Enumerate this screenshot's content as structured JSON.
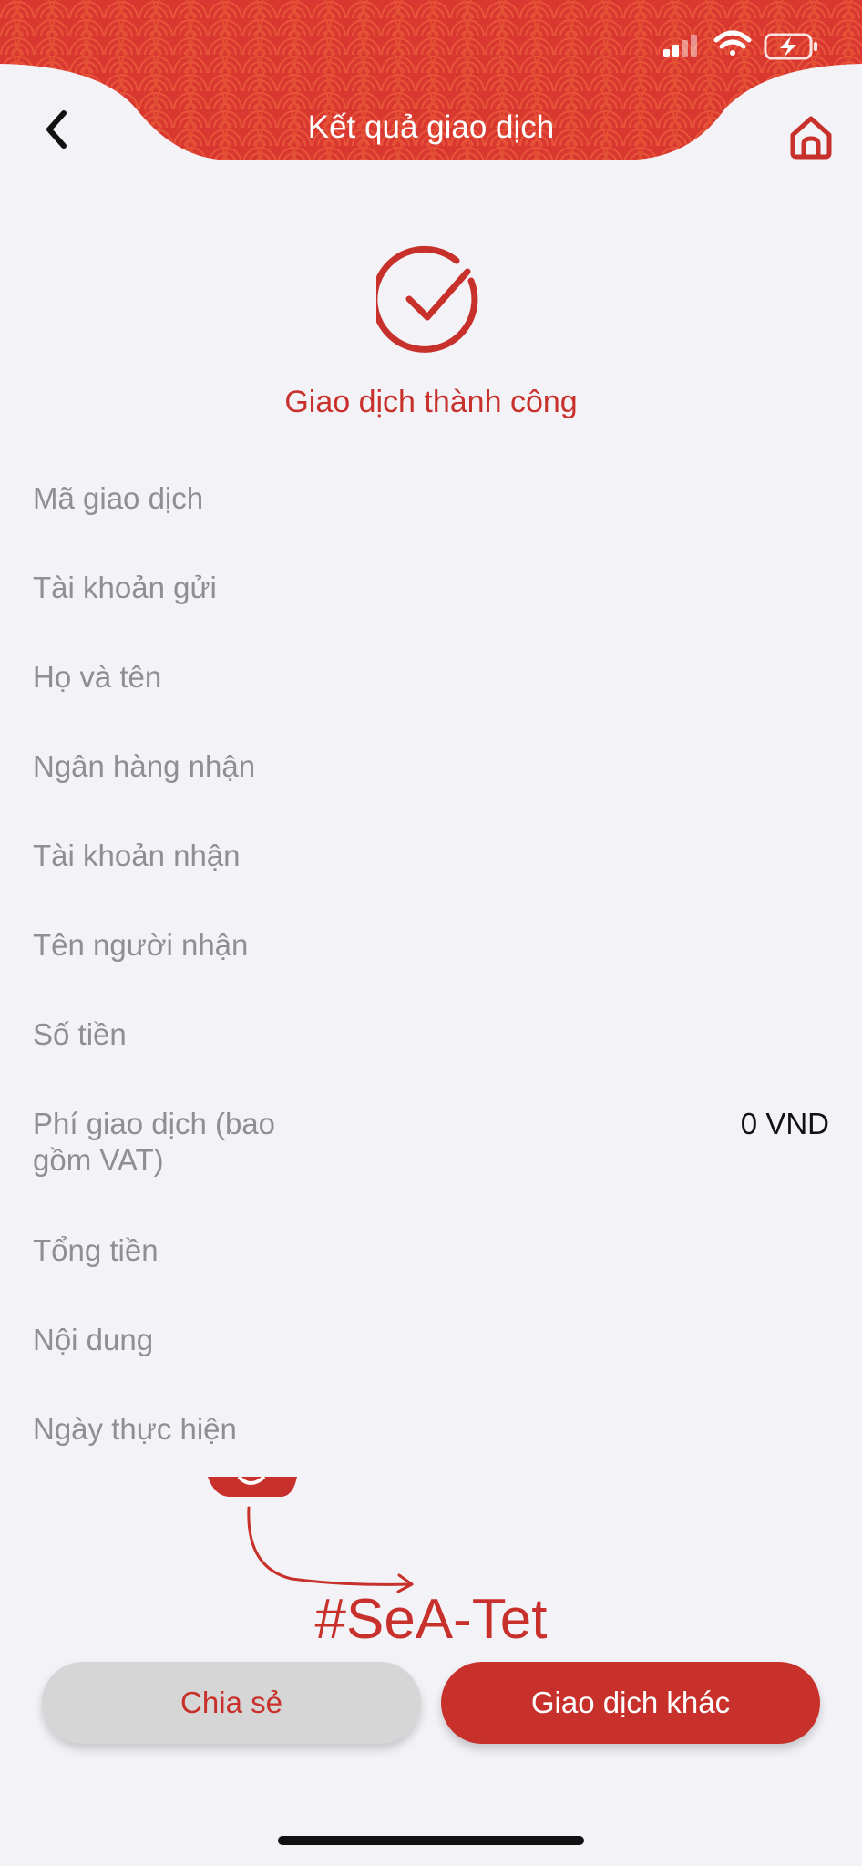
{
  "header": {
    "title": "Kết quả giao dịch",
    "back_icon": "chevron-left-icon",
    "home_icon": "home-icon",
    "accent_color": "#c8312b"
  },
  "status_bar": {
    "signal_icon": "signal-icon",
    "wifi_icon": "wifi-icon",
    "battery_icon": "battery-charging-icon"
  },
  "result": {
    "icon": "check-circle-icon",
    "message": "Giao dịch thành công"
  },
  "details": [
    {
      "label": "Mã giao dịch",
      "value": ""
    },
    {
      "label": "Tài khoản gửi",
      "value": ""
    },
    {
      "label": "Họ và tên",
      "value": ""
    },
    {
      "label": "Ngân hàng nhận",
      "value": ""
    },
    {
      "label": "Tài khoản nhận",
      "value": ""
    },
    {
      "label": "Tên người nhận",
      "value": ""
    },
    {
      "label": "Số tiền",
      "value": ""
    },
    {
      "label": "Phí giao dịch (bao gồm VAT)",
      "value": "0 VND"
    },
    {
      "label": "Tổng tiền",
      "value": ""
    },
    {
      "label": "Nội dung",
      "value": ""
    },
    {
      "label": "Ngày thực hiện",
      "value": ""
    }
  ],
  "decoration": {
    "tag": "#SeA-Tet"
  },
  "buttons": {
    "share_label": "Chia sẻ",
    "other_label": "Giao dịch khác"
  }
}
